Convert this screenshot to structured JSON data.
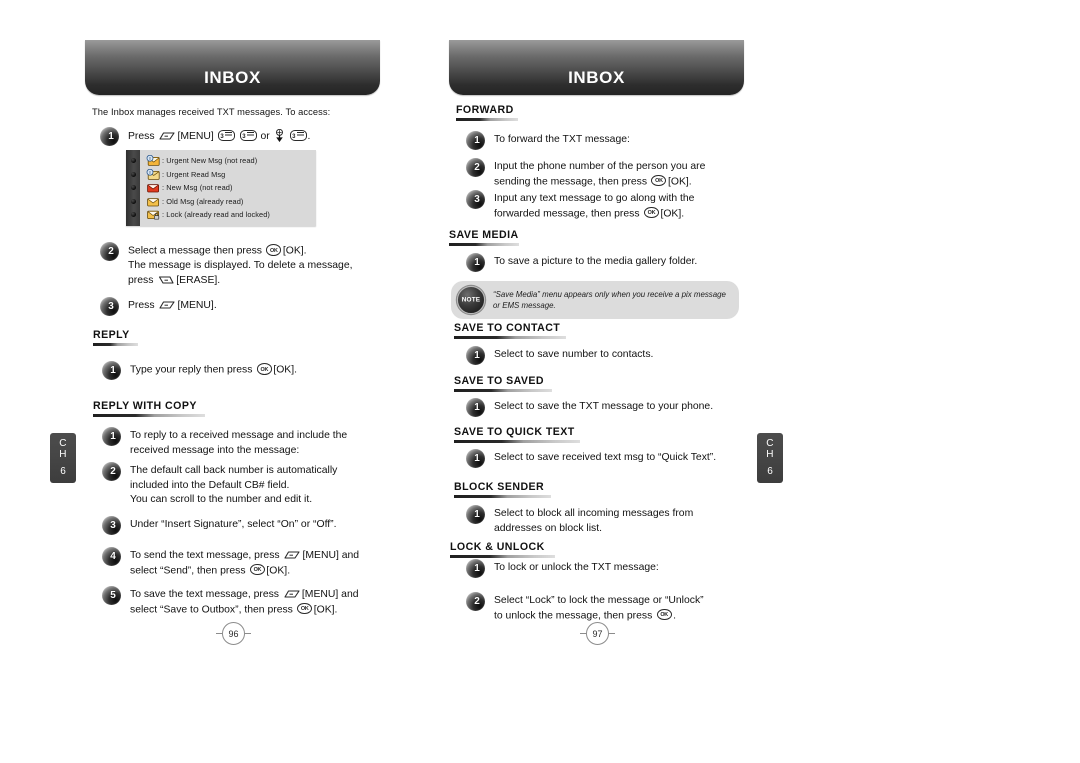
{
  "document": {
    "type": "phone-user-manual-spread",
    "chapter_tab": {
      "ch_line1": "C",
      "ch_line2": "H",
      "number": "6"
    }
  },
  "left_page": {
    "banner_title": "INBOX",
    "intro": "The Inbox manages received TXT messages. To access:",
    "page_number": "96",
    "steps_top": [
      {
        "num": "1",
        "lines": [
          "Press [MENU] or ."
        ]
      },
      {
        "num": "2",
        "lines": [
          "Select a message then press [OK].",
          "The message is displayed. To delete a message,",
          "press [ERASE]."
        ]
      },
      {
        "num": "3",
        "lines": [
          "Press [MENU]."
        ]
      }
    ],
    "legend": {
      "rows": [
        {
          "icon": "urgent-new-msg-icon",
          "text": ": Urgent New Msg (not read)"
        },
        {
          "icon": "urgent-read-msg-icon",
          "text": ": Urgent Read Msg"
        },
        {
          "icon": "new-msg-icon",
          "text": ": New Msg (not read)"
        },
        {
          "icon": "old-msg-icon",
          "text": ": Old Msg (already read)"
        },
        {
          "icon": "locked-msg-icon",
          "text": ": Lock (already read and locked)"
        }
      ]
    },
    "sections": [
      {
        "title": "REPLY",
        "steps": [
          {
            "num": "1",
            "lines": [
              "Type your reply then press [OK]."
            ]
          }
        ]
      },
      {
        "title": "REPLY WITH COPY",
        "steps": [
          {
            "num": "1",
            "lines": [
              "To reply to a received message and include the",
              "received message into the message:"
            ]
          },
          {
            "num": "2",
            "lines": [
              "The default call back number is automatically",
              "included into the Default CB# field.",
              "You can scroll to the number and edit it."
            ]
          },
          {
            "num": "3",
            "lines": [
              "Under “Insert Signature”, select “On” or “Off”."
            ]
          },
          {
            "num": "4",
            "lines": [
              "To send the text message, press [MENU] and",
              "select “Send”, then press [OK]."
            ]
          },
          {
            "num": "5",
            "lines": [
              "To save the text message, press [MENU] and",
              "select “Save to Outbox”, then press [OK]."
            ]
          }
        ]
      }
    ]
  },
  "right_page": {
    "banner_title": "INBOX",
    "page_number": "97",
    "sections": [
      {
        "title": "FORWARD",
        "steps": [
          {
            "num": "1",
            "lines": [
              "To forward the TXT message:"
            ]
          },
          {
            "num": "2",
            "lines": [
              "Input the phone number of the person you are",
              "sending the message, then press [OK]."
            ]
          },
          {
            "num": "3",
            "lines": [
              "Input any text message to go along with the",
              "forwarded message, then press [OK]."
            ]
          }
        ]
      },
      {
        "title": "SAVE MEDIA",
        "steps": [
          {
            "num": "1",
            "lines": [
              "To save a picture to the media gallery folder."
            ]
          }
        ],
        "note": {
          "badge_label": "NOTE",
          "lines": [
            "“Save Media” menu appears only when you receive a pix message",
            "or EMS message."
          ]
        }
      },
      {
        "title": "SAVE TO CONTACT",
        "steps": [
          {
            "num": "1",
            "lines": [
              "Select to save number to contacts."
            ]
          }
        ]
      },
      {
        "title": "SAVE TO SAVED",
        "steps": [
          {
            "num": "1",
            "lines": [
              "Select to save the TXT message to your phone."
            ]
          }
        ]
      },
      {
        "title": "SAVE TO QUICK TEXT",
        "steps": [
          {
            "num": "1",
            "lines": [
              "Select to save received text msg to “Quick Text”."
            ]
          }
        ]
      },
      {
        "title": "BLOCK SENDER",
        "steps": [
          {
            "num": "1",
            "lines": [
              "Select to block all incoming messages from",
              "addresses on block list."
            ]
          }
        ]
      },
      {
        "title": "LOCK & UNLOCK",
        "steps": [
          {
            "num": "1",
            "lines": [
              "To lock or unlock the TXT message:"
            ]
          },
          {
            "num": "2",
            "lines": [
              "Select “Lock” to lock the message or “Unlock”",
              "to unlock the message, then press ."
            ]
          }
        ]
      }
    ]
  },
  "key_glyphs": {
    "menu_softkey": "left-softkey-icon",
    "erase_softkey": "right-softkey-icon",
    "ok_key": "ok-key-icon",
    "nav_down_key": "navigation-down-key-icon",
    "digit_key_3": "3"
  }
}
